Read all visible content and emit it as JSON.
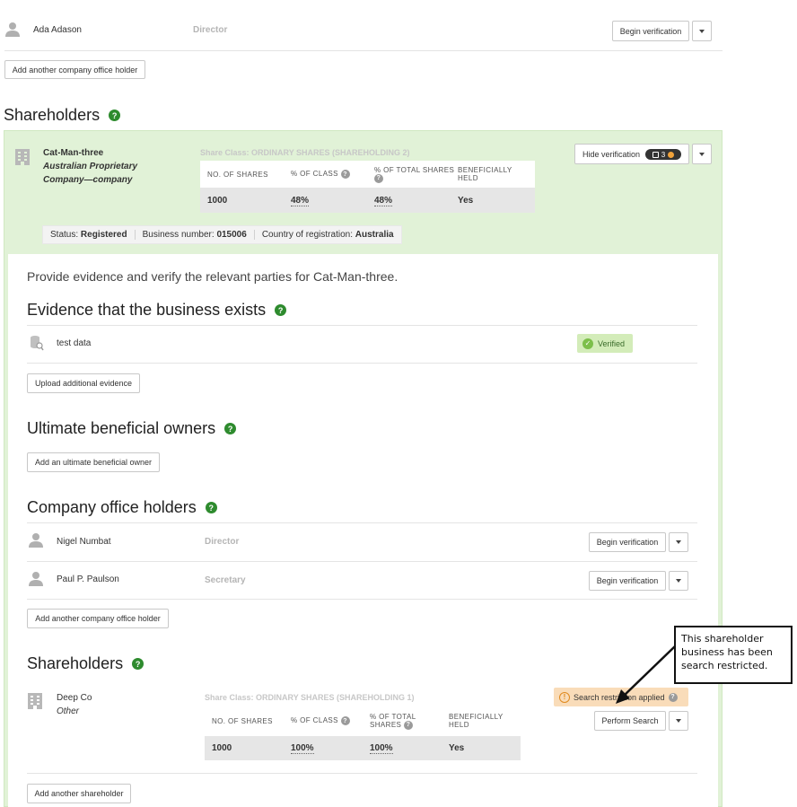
{
  "top_officer": {
    "name": "Ada Adason",
    "role": "Director",
    "verify_label": "Begin verification"
  },
  "add_office_holder_label": "Add another company office holder",
  "shareholders_title": "Shareholders",
  "help_glyph": "?",
  "cat": {
    "name": "Cat-Man-three",
    "type_line1": "Australian Proprietary",
    "type_line2": "Company—company",
    "share_class": "Share Class: ORDINARY SHARES (SHAREHOLDING 2)",
    "headers": [
      "NO. OF SHARES",
      "% OF CLASS",
      "% OF TOTAL SHARES",
      "BENEFICIALLY HELD"
    ],
    "values": [
      "1000",
      "48%",
      "48%",
      "Yes"
    ],
    "hide_label": "Hide verification",
    "badge_count": "3",
    "status_label": "Status:",
    "status_value": "Registered",
    "bn_label": "Business number:",
    "bn_value": "015006",
    "country_label": "Country of registration:",
    "country_value": "Australia"
  },
  "panel": {
    "intro": "Provide evidence and verify the relevant parties for Cat-Man-three.",
    "evidence_title": "Evidence that the business exists",
    "evidence_item": "test data",
    "verified_label": "Verified",
    "upload_label": "Upload additional evidence",
    "ubo_title": "Ultimate beneficial owners",
    "add_ubo_label": "Add an ultimate beneficial owner",
    "office_title": "Company office holders",
    "officers": [
      {
        "name": "Nigel Numbat",
        "role": "Director",
        "verify_label": "Begin verification"
      },
      {
        "name": "Paul P. Paulson",
        "role": "Secretary",
        "verify_label": "Begin verification"
      }
    ],
    "add_officer_label": "Add another company office holder",
    "shareholders_title": "Shareholders",
    "deep": {
      "name": "Deep Co",
      "type": "Other",
      "share_class": "Share Class: ORDINARY SHARES (SHAREHOLDING 1)",
      "headers": [
        "NO. OF SHARES",
        "% OF CLASS",
        "% OF TOTAL SHARES",
        "BENEFICIALLY HELD"
      ],
      "values": [
        "1000",
        "100%",
        "100%",
        "Yes"
      ],
      "restriction_label": "Search restriction applied",
      "perform_label": "Perform Search"
    },
    "add_shareholder_label": "Add another shareholder"
  },
  "annotation": {
    "line1": "This shareholder",
    "line2": "business has been",
    "line3": "search restricted."
  },
  "colors": {
    "green_bg": "#e1f2d7",
    "help_green": "#2e8b2e",
    "verified_bg": "#d3ecb9",
    "restriction_bg": "#f9dcb9"
  }
}
